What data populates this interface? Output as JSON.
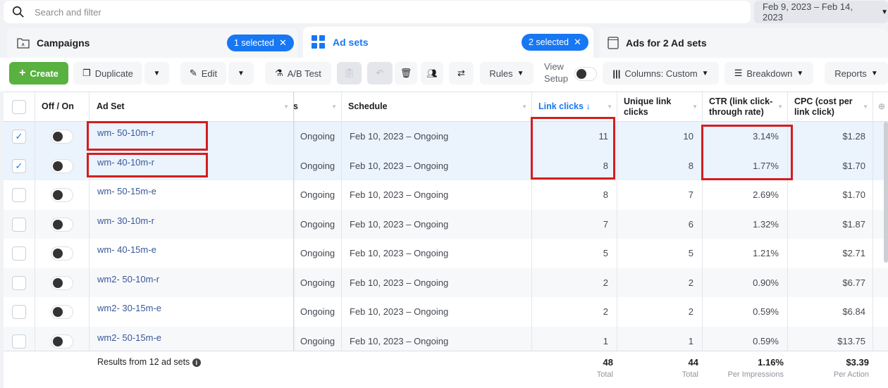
{
  "search": {
    "placeholder": "Search and filter"
  },
  "date_range": {
    "label": "Feb 9, 2023 – Feb 14, 2023"
  },
  "tabs": [
    {
      "label": "Campaigns",
      "icon": "folder-icon",
      "badge": "1 selected"
    },
    {
      "label": "Ad sets",
      "icon": "grid-icon",
      "badge": "2 selected",
      "active": true
    },
    {
      "label": "Ads for 2 Ad sets",
      "icon": "ad-window-icon"
    }
  ],
  "toolbar": {
    "create": "Create",
    "duplicate": "Duplicate",
    "edit": "Edit",
    "ab_test": "A/B Test",
    "rules": "Rules",
    "view_setup_line1": "View",
    "view_setup_line2": "Setup",
    "columns": "Columns: Custom",
    "breakdown": "Breakdown",
    "reports": "Reports"
  },
  "table": {
    "headers": {
      "off_on": "Off / On",
      "ad_set": "Ad Set",
      "delivery_partial": "s",
      "schedule": "Schedule",
      "link_clicks": "Link clicks",
      "unique_link_clicks": "Unique link clicks",
      "ctr": "CTR (link click-through rate)",
      "cpc": "CPC (cost per link click)"
    },
    "sort_indicator": "↓",
    "accent_color": "#1877f2",
    "highlight_color": "#d41e1e",
    "rows": [
      {
        "name": "wm- 50-10m-r",
        "delivery": "Ongoing",
        "schedule": "Feb 10, 2023 – Ongoing",
        "link_clicks": "11",
        "unique": "10",
        "ctr": "3.14%",
        "cpc": "$1.28",
        "selected": true
      },
      {
        "name": "wm- 40-10m-r",
        "delivery": "Ongoing",
        "schedule": "Feb 10, 2023 – Ongoing",
        "link_clicks": "8",
        "unique": "8",
        "ctr": "1.77%",
        "cpc": "$1.70",
        "selected": true
      },
      {
        "name": "wm- 50-15m-e",
        "delivery": "Ongoing",
        "schedule": "Feb 10, 2023 – Ongoing",
        "link_clicks": "8",
        "unique": "7",
        "ctr": "2.69%",
        "cpc": "$1.70",
        "selected": false
      },
      {
        "name": "wm- 30-10m-r",
        "delivery": "Ongoing",
        "schedule": "Feb 10, 2023 – Ongoing",
        "link_clicks": "7",
        "unique": "6",
        "ctr": "1.32%",
        "cpc": "$1.87",
        "selected": false
      },
      {
        "name": "wm- 40-15m-e",
        "delivery": "Ongoing",
        "schedule": "Feb 10, 2023 – Ongoing",
        "link_clicks": "5",
        "unique": "5",
        "ctr": "1.21%",
        "cpc": "$2.71",
        "selected": false
      },
      {
        "name": "wm2- 50-10m-r",
        "delivery": "Ongoing",
        "schedule": "Feb 10, 2023 – Ongoing",
        "link_clicks": "2",
        "unique": "2",
        "ctr": "0.90%",
        "cpc": "$6.77",
        "selected": false
      },
      {
        "name": "wm2- 30-15m-e",
        "delivery": "Ongoing",
        "schedule": "Feb 10, 2023 – Ongoing",
        "link_clicks": "2",
        "unique": "2",
        "ctr": "0.59%",
        "cpc": "$6.84",
        "selected": false
      },
      {
        "name": "wm2- 50-15m-e",
        "delivery": "Ongoing",
        "schedule": "Feb 10, 2023 – Ongoing",
        "link_clicks": "1",
        "unique": "1",
        "ctr": "0.59%",
        "cpc": "$13.75",
        "selected": false
      }
    ],
    "footer": {
      "results_label": "Results from 12 ad sets",
      "link_clicks": {
        "value": "48",
        "sub": "Total"
      },
      "unique": {
        "value": "44",
        "sub": "Total"
      },
      "ctr": {
        "value": "1.16%",
        "sub": "Per Impressions"
      },
      "cpc": {
        "value": "$3.39",
        "sub": "Per Action"
      }
    }
  }
}
